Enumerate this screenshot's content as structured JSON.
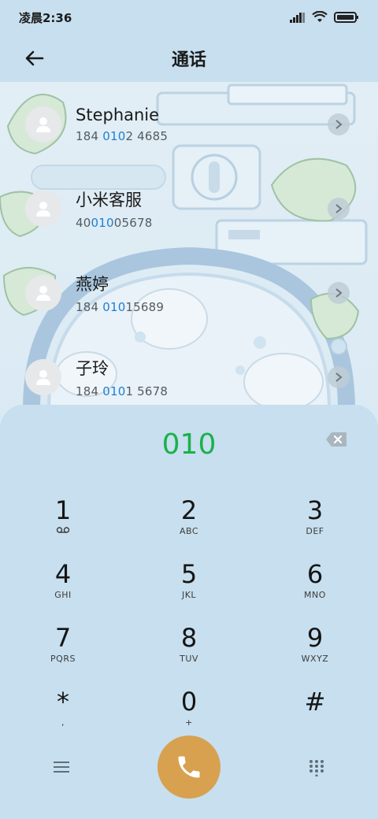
{
  "status_bar": {
    "time": "凌晨2:36"
  },
  "header": {
    "title": "通话"
  },
  "contacts": [
    {
      "name": "Stephanie",
      "number_pre": "184 ",
      "number_hl": "010",
      "number_post": "2 4685"
    },
    {
      "name": "小米客服",
      "number_pre": "40",
      "number_hl": "010",
      "number_post": "05678"
    },
    {
      "name": "燕婷",
      "number_pre": "184 ",
      "number_hl": "010",
      "number_post": "15689"
    },
    {
      "name": "子玲",
      "number_pre": "184 ",
      "number_hl": "010",
      "number_post": "1 5678"
    }
  ],
  "dialpad": {
    "input_value": "010",
    "keys": [
      {
        "digit": "1",
        "letters": ""
      },
      {
        "digit": "2",
        "letters": "ABC"
      },
      {
        "digit": "3",
        "letters": "DEF"
      },
      {
        "digit": "4",
        "letters": "GHI"
      },
      {
        "digit": "5",
        "letters": "JKL"
      },
      {
        "digit": "6",
        "letters": "MNO"
      },
      {
        "digit": "7",
        "letters": "PQRS"
      },
      {
        "digit": "8",
        "letters": "TUV"
      },
      {
        "digit": "9",
        "letters": "WXYZ"
      },
      {
        "digit": "*",
        "letters": ","
      },
      {
        "digit": "0",
        "letters": "+"
      },
      {
        "digit": "#",
        "letters": ""
      }
    ]
  },
  "colors": {
    "accent_green": "#1bb14c",
    "highlight_blue": "#1e7fd2",
    "call_button": "#d7a150",
    "panel_bg": "#c7dfee"
  },
  "icons": {
    "back": "arrow-left-icon",
    "backspace": "backspace-icon",
    "menu": "menu-icon",
    "call": "phone-icon",
    "dialpad": "dialpad-grid-icon",
    "voicemail": "voicemail-icon"
  }
}
